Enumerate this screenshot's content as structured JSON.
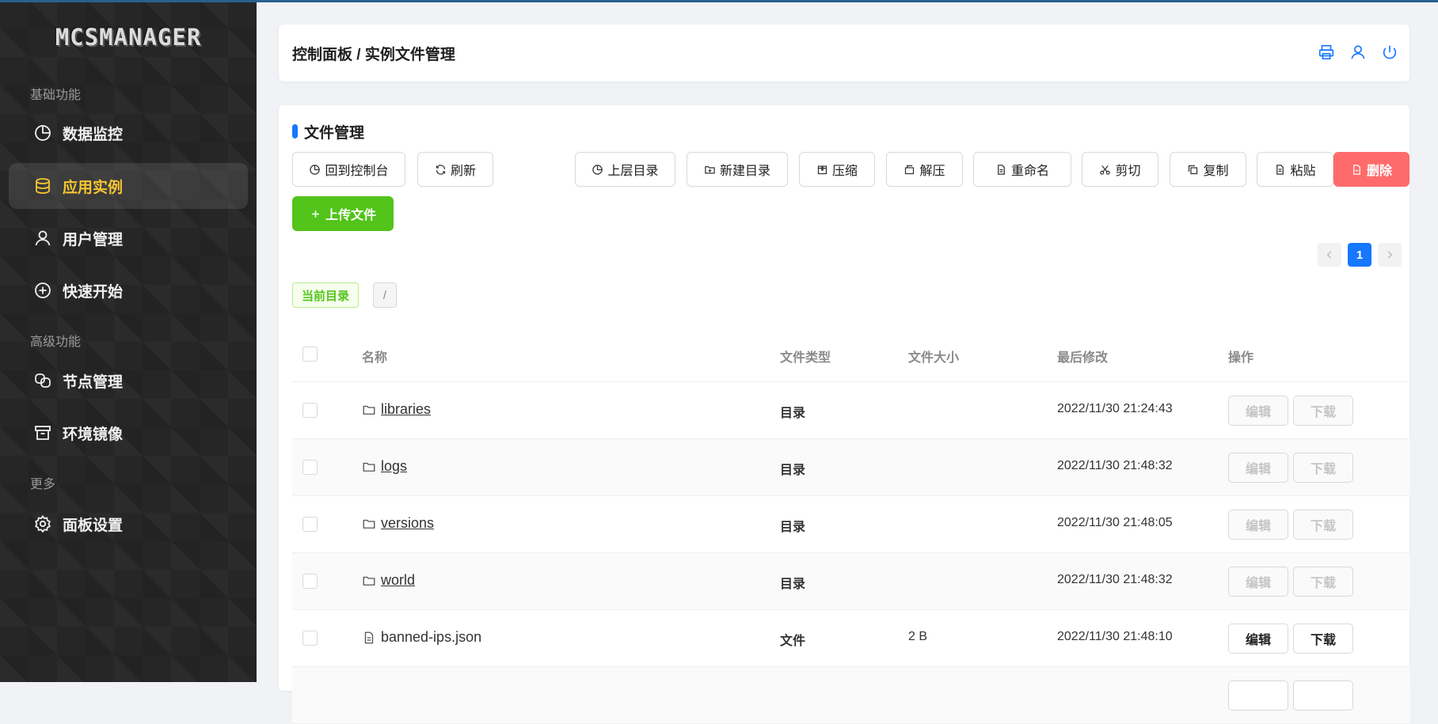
{
  "sidebar": {
    "logo": "MCSMANAGER",
    "groups": {
      "basic": "基础功能",
      "advanced": "高级功能",
      "more": "更多"
    },
    "items": [
      {
        "label": "数据监控"
      },
      {
        "label": "应用实例"
      },
      {
        "label": "用户管理"
      },
      {
        "label": "快速开始"
      },
      {
        "label": "节点管理"
      },
      {
        "label": "环境镜像"
      },
      {
        "label": "面板设置"
      }
    ],
    "active_color": "#f6c531"
  },
  "header": {
    "breadcrumb": "控制面板 / 实例文件管理"
  },
  "card": {
    "title": "文件管理",
    "buttons": {
      "console": "回到控制台",
      "refresh": "刷新",
      "parent": "上层目录",
      "new_dir": "新建目录",
      "compress": "压缩",
      "extract": "解压",
      "rename": "重命名",
      "cut": "剪切",
      "copy": "复制",
      "paste": "粘贴",
      "delete": "删除",
      "upload": "上传文件"
    },
    "pager": {
      "current": "1"
    },
    "current_dir_label": "当前目录",
    "current_path": "/"
  },
  "table": {
    "headers": {
      "name": "名称",
      "type": "文件类型",
      "size": "文件大小",
      "modified": "最后修改",
      "actions": "操作"
    },
    "edit_label": "编辑",
    "download_label": "下载",
    "rows": [
      {
        "name": "libraries",
        "type": "目录",
        "size": "",
        "modified": "2022/11/30 21:24:43",
        "kind": "folder"
      },
      {
        "name": "logs",
        "type": "目录",
        "size": "",
        "modified": "2022/11/30 21:48:32",
        "kind": "folder"
      },
      {
        "name": "versions",
        "type": "目录",
        "size": "",
        "modified": "2022/11/30 21:48:05",
        "kind": "folder"
      },
      {
        "name": "world",
        "type": "目录",
        "size": "",
        "modified": "2022/11/30 21:48:32",
        "kind": "folder"
      },
      {
        "name": "banned-ips.json",
        "type": "文件",
        "size": "2 B",
        "modified": "2022/11/30 21:48:10",
        "kind": "file"
      }
    ]
  },
  "colors": {
    "primary": "#1677ff",
    "danger": "#ff6b6b",
    "success": "#52c41a",
    "header_icon": "#1677ff"
  }
}
